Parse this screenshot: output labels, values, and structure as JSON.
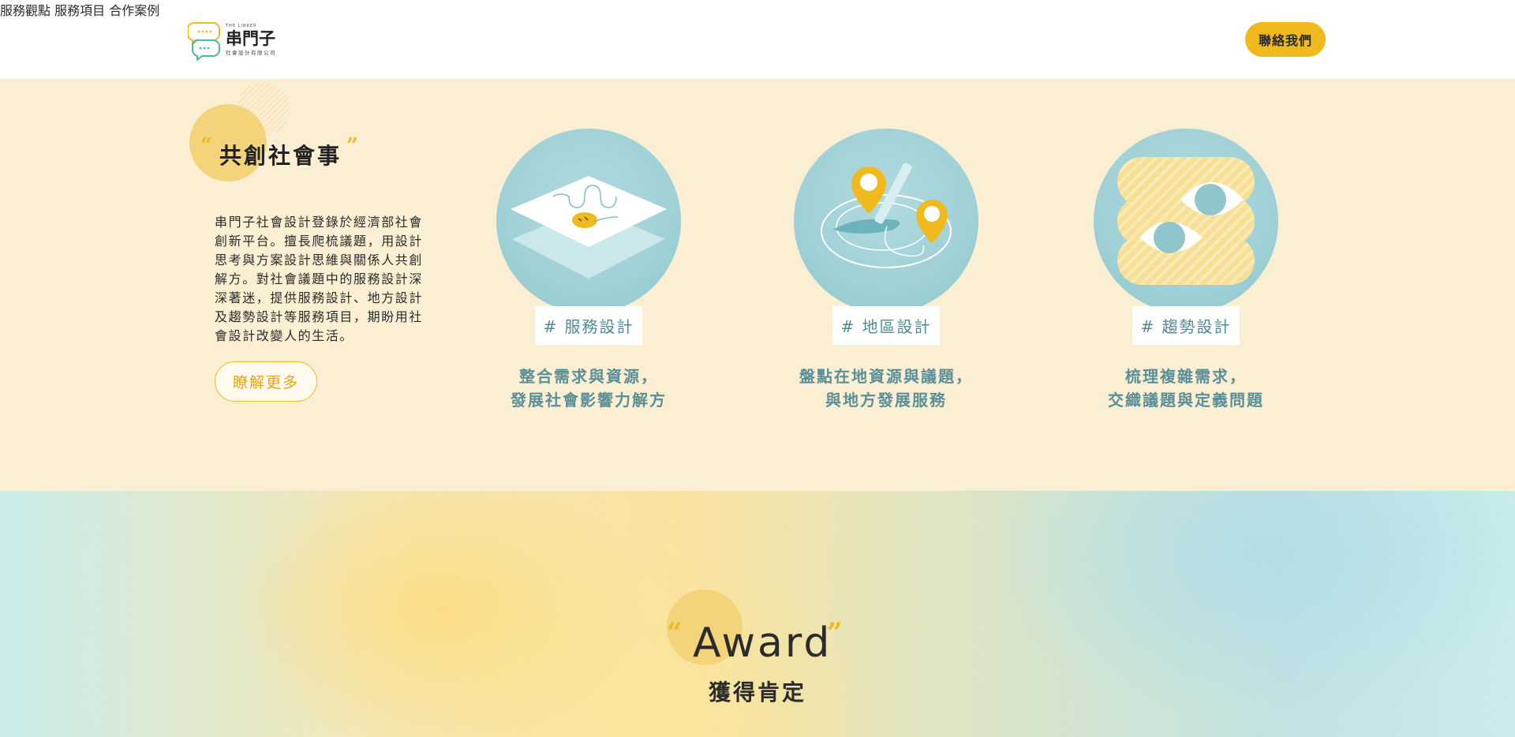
{
  "header": {
    "logo": {
      "en": "THE LINKER",
      "cn": "串門子",
      "sub": "社會設計有限公司"
    },
    "nav": [
      "服務觀點",
      "服務項目",
      "合作案例"
    ],
    "contact_label": "聯絡我們"
  },
  "intro": {
    "open_quote": "“",
    "close_quote": "”",
    "title": "共創社會事",
    "lines": [
      "串門子社會設計登錄於經濟部社會",
      "創新平台。擅長爬梳議題，用設計",
      "思考與方案設計思維與關係人共創",
      "解方。對社會議題中的服務設計深",
      "深著迷，提供服務設計、地方設計",
      "及趨勢設計等服務項目，期盼用社",
      "會設計改變人的生活。"
    ],
    "more_label": "瞭解更多"
  },
  "services": [
    {
      "tag": "# 服務設計",
      "desc1": "整合需求與資源，",
      "desc2": "發展社會影響力解方",
      "icon": "layers-icon"
    },
    {
      "tag": "# 地區設計",
      "desc1": "盤點在地資源與議題，",
      "desc2": "與地方發展服務",
      "icon": "map-pin-icon"
    },
    {
      "tag": "# 趨勢設計",
      "desc1": "梳理複雜需求，",
      "desc2": "交織議題與定義問題",
      "icon": "eyes-icon"
    }
  ],
  "award": {
    "open_quote": "“",
    "close_quote": "”",
    "title": "Award",
    "subtitle": "獲得肯定"
  },
  "colors": {
    "accent": "#f0b91e",
    "teal_text": "#5b8f97",
    "cream_bg": "#fbefd3"
  }
}
